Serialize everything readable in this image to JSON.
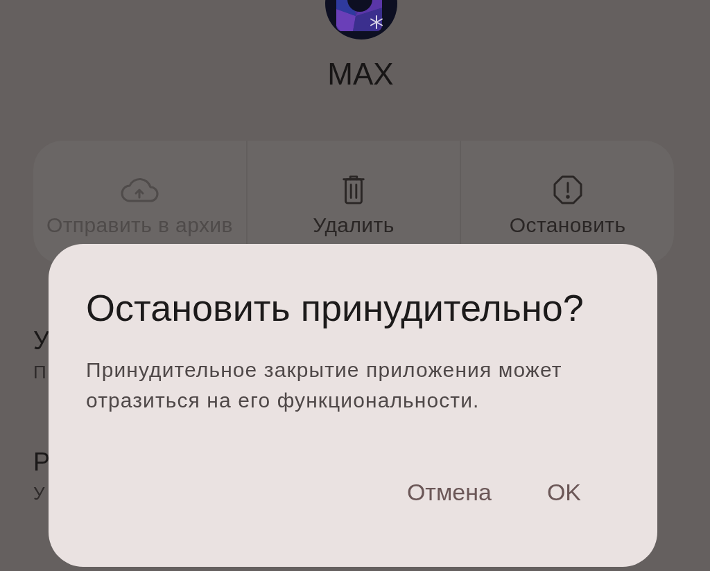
{
  "app": {
    "name": "MAX"
  },
  "actions": [
    {
      "kind": "archive",
      "label": "Отправить в архив",
      "disabled": true
    },
    {
      "kind": "delete",
      "label": "Удалить",
      "disabled": false
    },
    {
      "kind": "stop",
      "label": "Остановить",
      "disabled": false
    }
  ],
  "settings_items": [
    {
      "title": "У",
      "subtitle": "П"
    },
    {
      "title": "Р",
      "subtitle": "У"
    }
  ],
  "dialog": {
    "title": "Остановить принудительно?",
    "message": "Принудительное закрытие приложения может отразиться на его функциональности.",
    "buttons": [
      "Отмена",
      "OK"
    ]
  }
}
